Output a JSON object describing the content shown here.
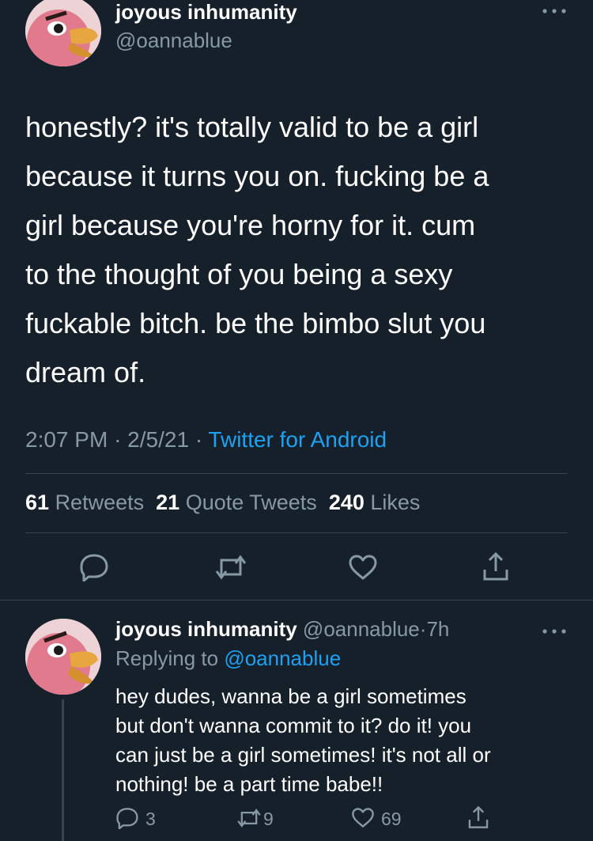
{
  "main_tweet": {
    "display_name": "joyous inhumanity",
    "handle": "@oannablue",
    "text_lines": [
      "honestly? it's totally valid to be a girl",
      "because it turns you on. fucking be a",
      "girl because you're horny for it. cum",
      "to the thought of you being a sexy",
      "fuckable bitch. be the bimbo slut you",
      "dream of."
    ],
    "time": "2:07 PM",
    "date": "2/5/21",
    "sep": "·",
    "source": "Twitter for Android",
    "stats": {
      "retweets_count": "61",
      "retweets_label": "Retweets",
      "quotes_count": "21",
      "quotes_label": "Quote Tweets",
      "likes_count": "240",
      "likes_label": "Likes"
    }
  },
  "reply_tweet": {
    "display_name": "joyous inhumanity",
    "handle": "@oannablue",
    "sep": "·",
    "age": "7h",
    "replying_label": "Replying to",
    "replying_to": "@oannablue",
    "text_lines": [
      "hey dudes, wanna be a girl sometimes",
      "but don't wanna commit to it? do it! you",
      "can just be a girl sometimes! it's not all or",
      "nothing! be a part time babe!!"
    ],
    "reply_count": "3",
    "retweet_count": "9",
    "like_count": "69"
  },
  "colors": {
    "background": "#15202b",
    "text": "#ffffff",
    "muted": "#8899a6",
    "accent": "#1da1f2",
    "divider": "#38444d"
  },
  "icons": [
    "more-icon",
    "reply-icon",
    "retweet-icon",
    "like-icon",
    "share-icon",
    "avatar"
  ]
}
